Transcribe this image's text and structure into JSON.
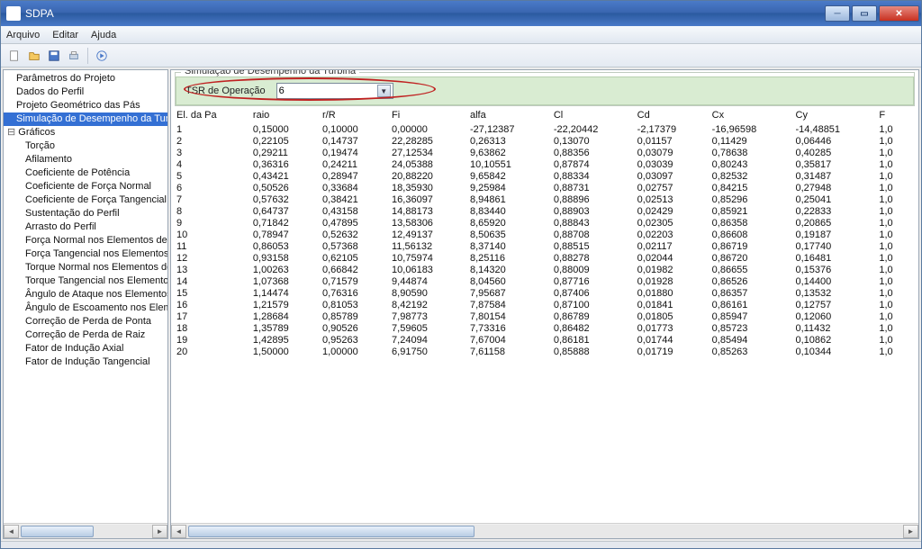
{
  "window": {
    "title": "SDPA"
  },
  "menu": {
    "arquivo": "Arquivo",
    "editar": "Editar",
    "ajuda": "Ajuda"
  },
  "tree": {
    "parametros": "Parâmetros do Projeto",
    "dados_perfil": "Dados do Perfil",
    "projeto_geom": "Projeto Geométrico das Pás",
    "simulacao": "Simulação de Desempenho da Turbina",
    "graficos": "Gráficos",
    "children": {
      "torcao": "Torção",
      "afilamento": "Afilamento",
      "coef_potencia": "Coeficiente de Potência",
      "coef_fn": "Coeficiente de Força Normal",
      "coef_ft": "Coeficiente de Força Tangencial",
      "sustentacao": "Sustentação do Perfil",
      "arrasto": "Arrasto do Perfil",
      "forca_normal": "Força Normal nos Elementos de Pá",
      "forca_tang": "Força Tangencial nos  Elementos de",
      "torque_normal": "Torque Normal nos Elementos de Pá",
      "torque_tang": "Torque Tangencial nos  Elementos d",
      "ang_ataque": "Ângulo de Ataque nos Elementos de",
      "ang_escoamento": "Ângulo de Escoamento nos Element",
      "corr_ponta": "Correção de Perda  de Ponta",
      "corr_raiz": "Correção de Perda de Raiz",
      "fator_axial": "Fator de Indução Axial",
      "fator_tang": "Fator de Indução Tangencial"
    }
  },
  "panel": {
    "group_title": "Simulação de Desempenho da Turbina",
    "tsr_label": "TSR de Operação",
    "tsr_value": "6"
  },
  "table": {
    "headers": [
      "El. da Pa",
      "raio",
      "r/R",
      "Fi",
      "alfa",
      "Cl",
      "Cd",
      "Cx",
      "Cy",
      "F"
    ],
    "rows": [
      [
        "1",
        "0,15000",
        "0,10000",
        "0,00000",
        "-27,12387",
        "-22,20442",
        "-2,17379",
        "-16,96598",
        "-14,48851",
        "1,0"
      ],
      [
        "2",
        "0,22105",
        "0,14737",
        "22,28285",
        "0,26313",
        "0,13070",
        "0,01157",
        "0,11429",
        "0,06446",
        "1,0"
      ],
      [
        "3",
        "0,29211",
        "0,19474",
        "27,12534",
        "9,63862",
        "0,88356",
        "0,03079",
        "0,78638",
        "0,40285",
        "1,0"
      ],
      [
        "4",
        "0,36316",
        "0,24211",
        "24,05388",
        "10,10551",
        "0,87874",
        "0,03039",
        "0,80243",
        "0,35817",
        "1,0"
      ],
      [
        "5",
        "0,43421",
        "0,28947",
        "20,88220",
        "9,65842",
        "0,88334",
        "0,03097",
        "0,82532",
        "0,31487",
        "1,0"
      ],
      [
        "6",
        "0,50526",
        "0,33684",
        "18,35930",
        "9,25984",
        "0,88731",
        "0,02757",
        "0,84215",
        "0,27948",
        "1,0"
      ],
      [
        "7",
        "0,57632",
        "0,38421",
        "16,36097",
        "8,94861",
        "0,88896",
        "0,02513",
        "0,85296",
        "0,25041",
        "1,0"
      ],
      [
        "8",
        "0,64737",
        "0,43158",
        "14,88173",
        "8,83440",
        "0,88903",
        "0,02429",
        "0,85921",
        "0,22833",
        "1,0"
      ],
      [
        "9",
        "0,71842",
        "0,47895",
        "13,58306",
        "8,65920",
        "0,88843",
        "0,02305",
        "0,86358",
        "0,20865",
        "1,0"
      ],
      [
        "10",
        "0,78947",
        "0,52632",
        "12,49137",
        "8,50635",
        "0,88708",
        "0,02203",
        "0,86608",
        "0,19187",
        "1,0"
      ],
      [
        "11",
        "0,86053",
        "0,57368",
        "11,56132",
        "8,37140",
        "0,88515",
        "0,02117",
        "0,86719",
        "0,17740",
        "1,0"
      ],
      [
        "12",
        "0,93158",
        "0,62105",
        "10,75974",
        "8,25116",
        "0,88278",
        "0,02044",
        "0,86720",
        "0,16481",
        "1,0"
      ],
      [
        "13",
        "1,00263",
        "0,66842",
        "10,06183",
        "8,14320",
        "0,88009",
        "0,01982",
        "0,86655",
        "0,15376",
        "1,0"
      ],
      [
        "14",
        "1,07368",
        "0,71579",
        "9,44874",
        "8,04560",
        "0,87716",
        "0,01928",
        "0,86526",
        "0,14400",
        "1,0"
      ],
      [
        "15",
        "1,14474",
        "0,76316",
        "8,90590",
        "7,95687",
        "0,87406",
        "0,01880",
        "0,86357",
        "0,13532",
        "1,0"
      ],
      [
        "16",
        "1,21579",
        "0,81053",
        "8,42192",
        "7,87584",
        "0,87100",
        "0,01841",
        "0,86161",
        "0,12757",
        "1,0"
      ],
      [
        "17",
        "1,28684",
        "0,85789",
        "7,98773",
        "7,80154",
        "0,86789",
        "0,01805",
        "0,85947",
        "0,12060",
        "1,0"
      ],
      [
        "18",
        "1,35789",
        "0,90526",
        "7,59605",
        "7,73316",
        "0,86482",
        "0,01773",
        "0,85723",
        "0,11432",
        "1,0"
      ],
      [
        "19",
        "1,42895",
        "0,95263",
        "7,24094",
        "7,67004",
        "0,86181",
        "0,01744",
        "0,85494",
        "0,10862",
        "1,0"
      ],
      [
        "20",
        "1,50000",
        "1,00000",
        "6,91750",
        "7,61158",
        "0,85888",
        "0,01719",
        "0,85263",
        "0,10344",
        "1,0"
      ]
    ]
  }
}
